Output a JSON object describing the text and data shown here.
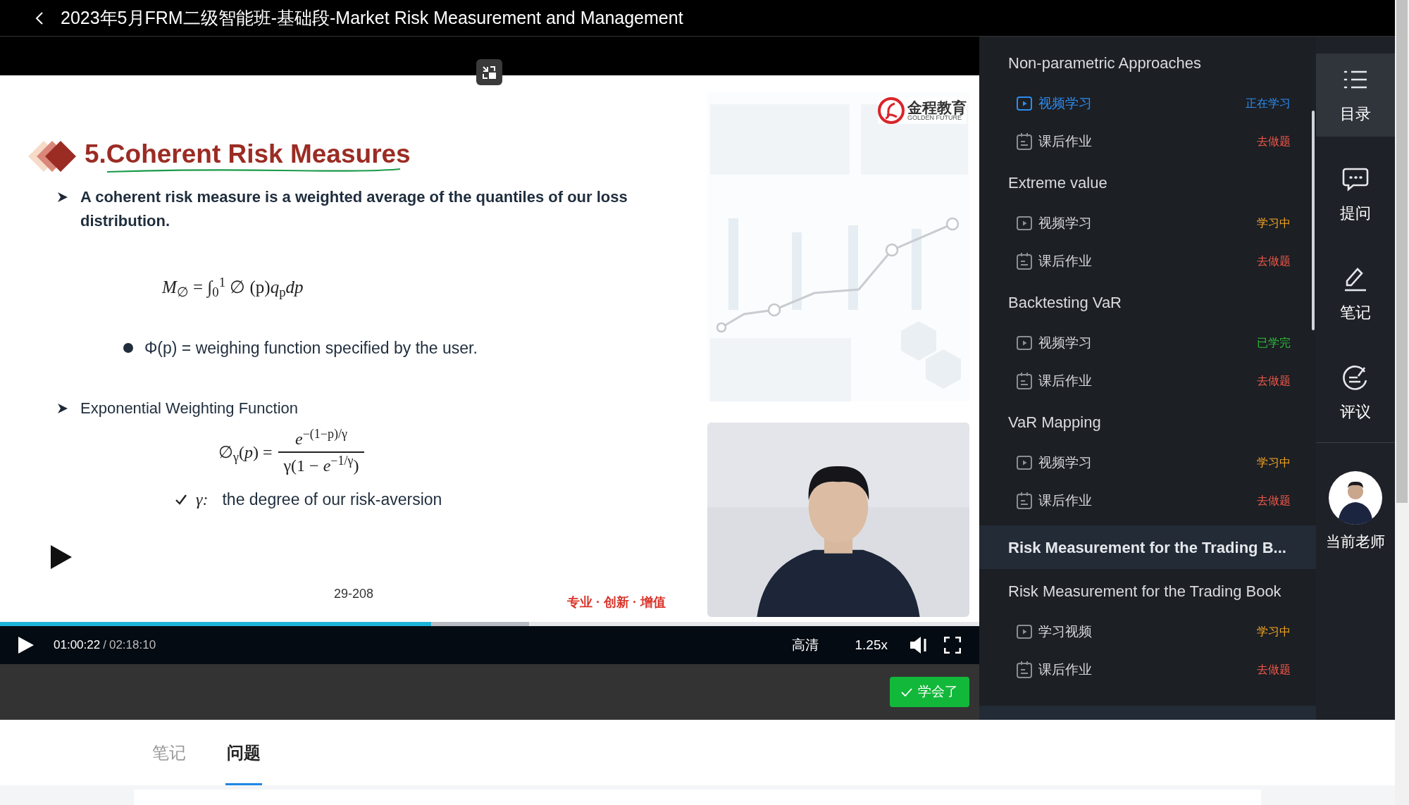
{
  "header": {
    "title": "2023年5月FRM二级智能班-基础段-Market Risk Measurement and Management"
  },
  "slide": {
    "title": "5.Coherent Risk Measures",
    "logo": {
      "name": "金程教育",
      "tagline": "GOLDEN FUTURE"
    },
    "blocks": [
      {
        "kind": "arrow",
        "text": "A coherent risk measure is a weighted average of the quantiles of our loss distribution.",
        "bold": true
      },
      {
        "kind": "formula",
        "text": "*M*$_{∅}$ = ∫$_{0}$$^{1}$ ∅ (p)*q*$_{p}$*dp*"
      },
      {
        "kind": "dot",
        "text": "Φ(p) = weighing function specified by the user."
      },
      {
        "kind": "arrow",
        "text": "Exponential Weighting Function",
        "bold": false
      },
      {
        "kind": "fraction",
        "lhs": "∅$_{γ}$(*p*) =",
        "numerator": "*e*$^{−(1−p)/γ}$",
        "denominator": "γ(1 − *e*$^{−1/γ}$)"
      },
      {
        "kind": "check",
        "symbol": "γ:",
        "text": "the degree of our risk-aversion"
      }
    ],
    "page": "29-208",
    "slogan": "专业 · 创新 · 增值"
  },
  "player": {
    "time": "01:00:22",
    "separator": "/",
    "duration": "02:18:10",
    "progress": {
      "level": 0.44,
      "buffered": {
        "level": 0.54
      }
    },
    "quality": "高清",
    "speed": "1.25x",
    "learned_button": "学会了"
  },
  "outline": [
    {
      "kind": "section",
      "title": "Non-parametric Approaches",
      "items": [
        {
          "kind": "video",
          "label": "视频学习",
          "status": "正在学习",
          "color": "#2d8cf0",
          "selected": true
        },
        {
          "kind": "homework",
          "label": "课后作业",
          "status": "去做题",
          "color": "#f0584a",
          "selected": false
        }
      ]
    },
    {
      "kind": "section",
      "title": "Extreme value",
      "items": [
        {
          "kind": "video",
          "label": "视频学习",
          "status": "学习中",
          "color": "#f5a623",
          "selected": false
        },
        {
          "kind": "homework",
          "label": "课后作业",
          "status": "去做题",
          "color": "#f0584a",
          "selected": false
        }
      ]
    },
    {
      "kind": "section",
      "title": "Backtesting VaR",
      "items": [
        {
          "kind": "video",
          "label": "视频学习",
          "status": "已学完",
          "color": "#2ebd3b",
          "selected": false
        },
        {
          "kind": "homework",
          "label": "课后作业",
          "status": "去做题",
          "color": "#f0584a",
          "selected": false
        }
      ]
    },
    {
      "kind": "section",
      "title": "VaR Mapping",
      "items": [
        {
          "kind": "video",
          "label": "视频学习",
          "status": "学习中",
          "color": "#f5a623",
          "selected": false
        },
        {
          "kind": "homework",
          "label": "课后作业",
          "status": "去做题",
          "color": "#f0584a",
          "selected": false
        }
      ]
    },
    {
      "kind": "chapter",
      "title": "Risk Measurement for the Trading B..."
    },
    {
      "kind": "section",
      "title": "Risk Measurement for the Trading Book",
      "items": [
        {
          "kind": "video",
          "label": "学习视频",
          "status": "学习中",
          "color": "#f5a623",
          "selected": false
        },
        {
          "kind": "homework",
          "label": "课后作业",
          "status": "去做题",
          "color": "#f0584a",
          "selected": false
        }
      ]
    }
  ],
  "rail": [
    {
      "label": "目录",
      "selected": true
    },
    {
      "label": "提问",
      "selected": false
    },
    {
      "label": "笔记",
      "selected": false
    },
    {
      "label": "评议",
      "selected": false
    }
  ],
  "teacher": {
    "label": "当前老师"
  },
  "tabs": [
    {
      "label": "笔记",
      "selected": false
    },
    {
      "label": "问题",
      "selected": true
    }
  ]
}
